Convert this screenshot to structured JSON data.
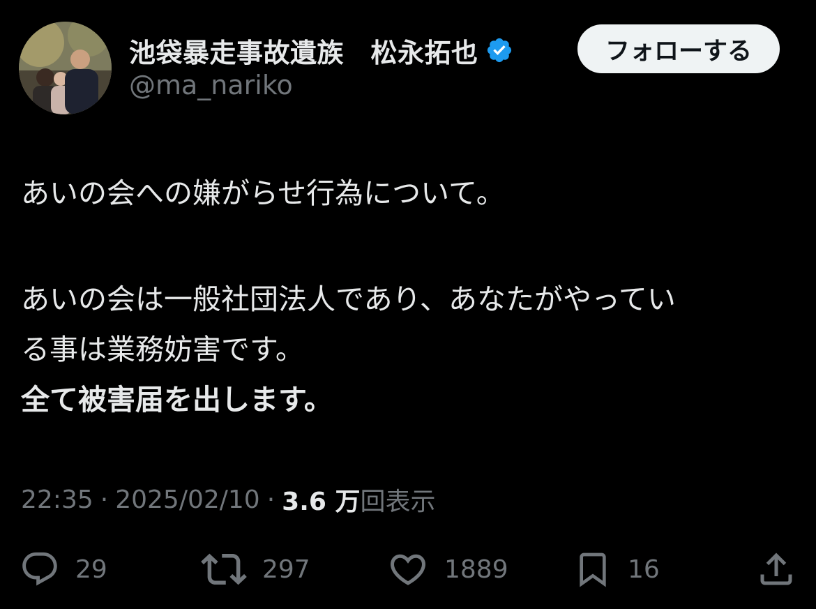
{
  "author": {
    "display_name": "池袋暴走事故遺族　松永拓也",
    "handle": "@ma_nariko",
    "verified": true,
    "verified_color": "#1d9bf0"
  },
  "follow_button": {
    "label": "フォローする"
  },
  "tweet": {
    "lines": [
      "あいの会への嫌がらせ行為について。",
      "あいの会は一般社団法人であり、あなたがやってい",
      "る事は業務妨害です。",
      "全て被害届を出します。"
    ]
  },
  "meta": {
    "time": "22:35",
    "date": "2025/02/10",
    "separator": "·",
    "views_count": "3.6 万",
    "views_label": "回表示"
  },
  "actions": {
    "replies": "29",
    "reposts": "297",
    "likes": "1889",
    "bookmarks": "16"
  },
  "icons": {
    "reply": "reply-icon",
    "repost": "repost-icon",
    "like": "heart-icon",
    "bookmark": "bookmark-icon",
    "share": "share-icon"
  },
  "colors": {
    "background": "#000000",
    "text": "#e7e9ea",
    "secondary": "#71767b",
    "button_bg": "#eff3f4"
  }
}
